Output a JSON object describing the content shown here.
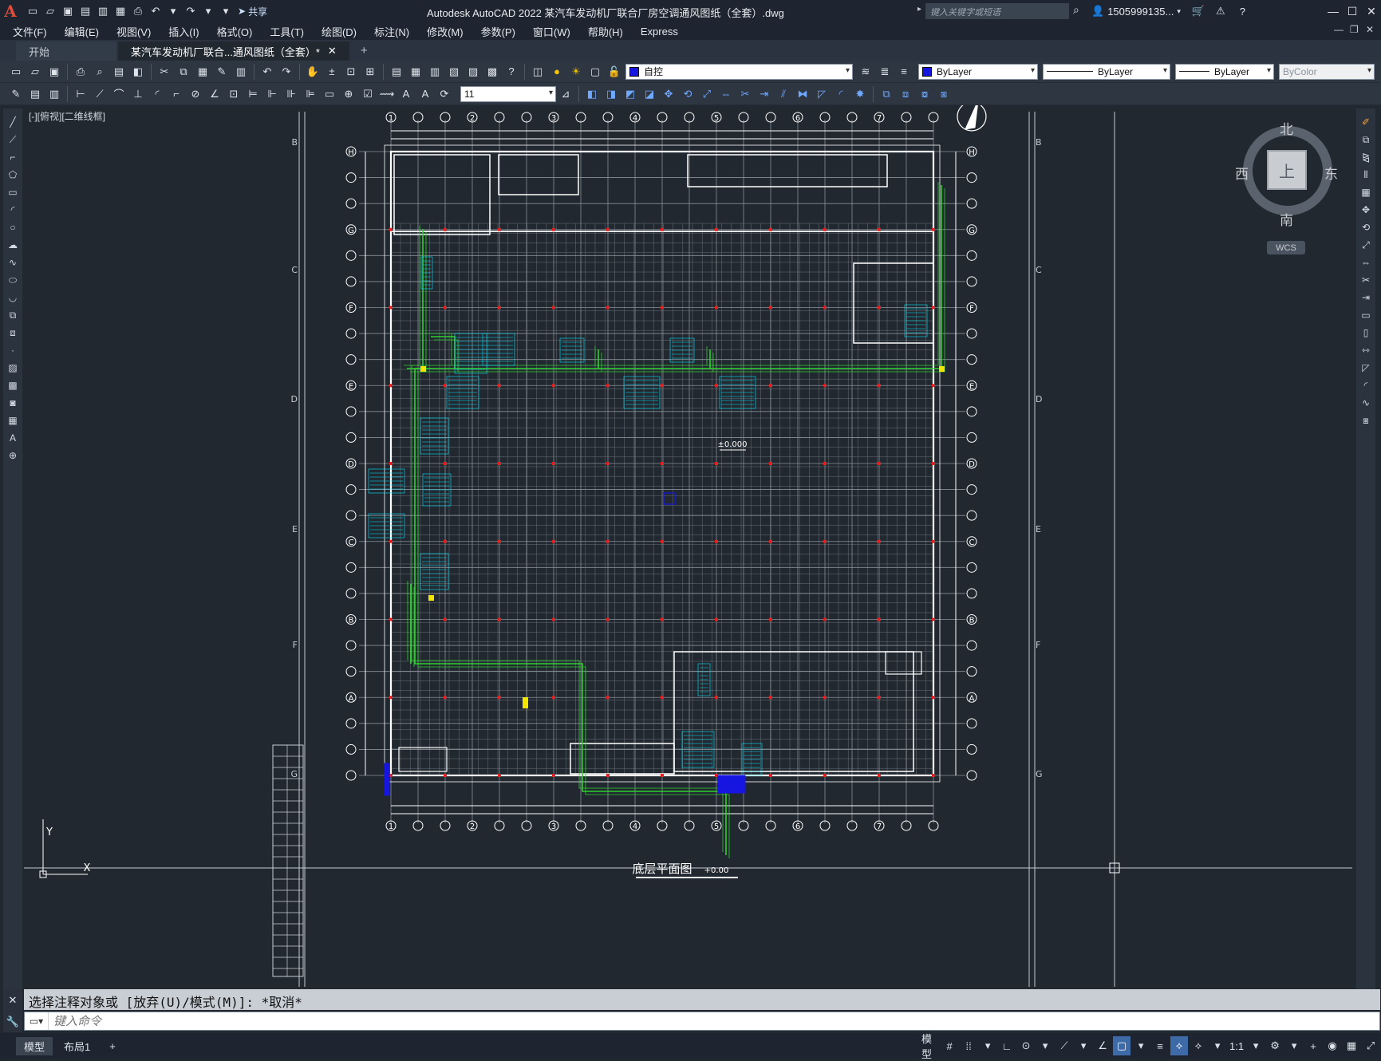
{
  "app": {
    "logo": "A",
    "title": "Autodesk AutoCAD 2022    某汽车发动机厂联合厂房空调通风图纸（全套）.dwg",
    "share_label": "共享",
    "search_placeholder": "键入关键字或短语",
    "user_name": "1505999135..."
  },
  "menu": [
    "文件(F)",
    "编辑(E)",
    "视图(V)",
    "插入(I)",
    "格式(O)",
    "工具(T)",
    "绘图(D)",
    "标注(N)",
    "修改(M)",
    "参数(P)",
    "窗口(W)",
    "帮助(H)",
    "Express"
  ],
  "tabs": [
    {
      "label": "开始"
    },
    {
      "label": "某汽车发动机厂联合...通风图纸（全套）*"
    }
  ],
  "properties": {
    "layer": "自控",
    "color": "ByLayer",
    "linetype": "ByLayer",
    "lineweight": "ByLayer",
    "plotstyle": "ByColor",
    "dim_style_value": "11"
  },
  "viewport": {
    "label": "[-][俯视][二维线框]"
  },
  "viewcube": {
    "north": "北",
    "south": "南",
    "east": "东",
    "west": "西",
    "face": "上",
    "wcs": "WCS"
  },
  "drawing": {
    "title": "底层平面图",
    "scale_note": "+0.00",
    "elevation": "±0.000",
    "grid_top": [
      "1",
      "2",
      "3",
      "4",
      "5",
      "6",
      "7"
    ],
    "grid_left": [
      "H",
      "G",
      "F",
      "E",
      "D",
      "C",
      "B",
      "A"
    ],
    "frame_letters": [
      "B",
      "C",
      "D",
      "E",
      "F",
      "G"
    ],
    "ucs_x": "X",
    "ucs_y": "Y"
  },
  "command": {
    "history": "选择注释对象或 [放弃(U)/模式(M)]: *取消*",
    "input_placeholder": "键入命令"
  },
  "status": {
    "model_tab": "模型",
    "layout_tab": "布局1",
    "model_label": "模型",
    "annotation_scale": "1:1"
  },
  "colors": {
    "background": "#212830",
    "duct_green": "#2fd02f",
    "annotation_cyan": "#00e5ff",
    "grid_gray": "#8a8f96",
    "wall_white": "#ffffff",
    "marker_red": "#e02020",
    "accent_blue": "#1616e0"
  }
}
